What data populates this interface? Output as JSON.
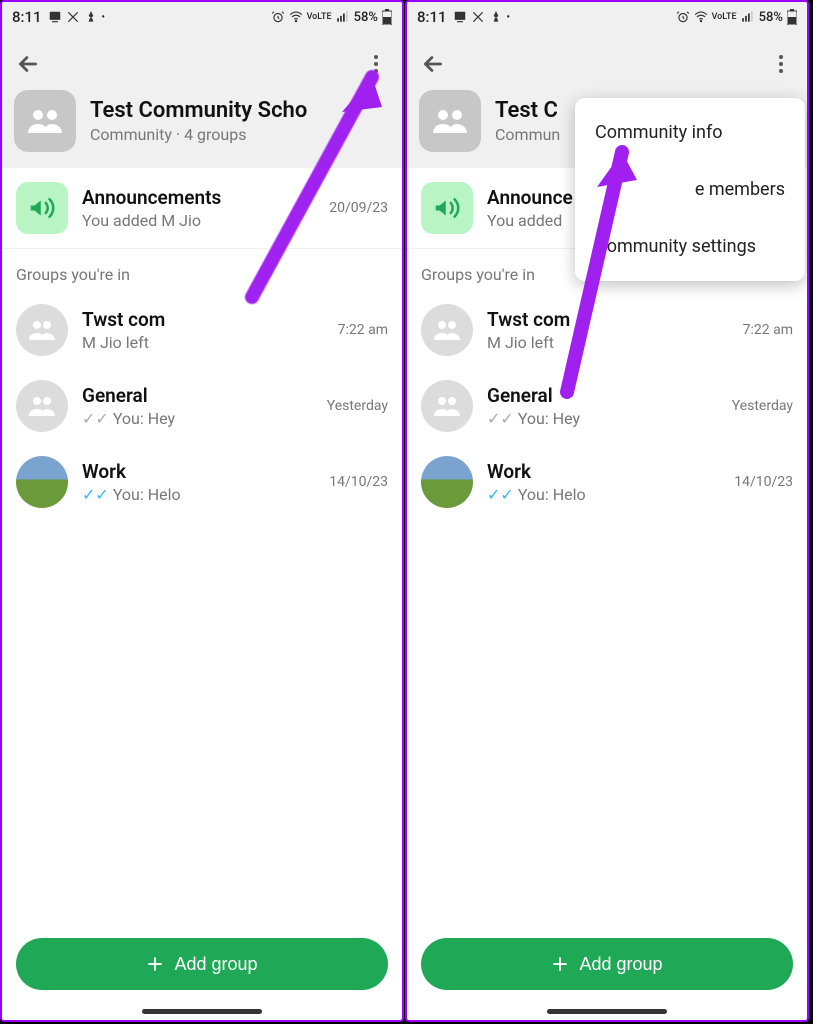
{
  "statusbar": {
    "time": "8:11",
    "battery": "58%"
  },
  "header": {
    "community_title": "Test Community School",
    "community_title_truncated_left": "Test Community Scho",
    "community_title_truncated_right": "Test C",
    "subtitle": "Community · 4 groups"
  },
  "announcements": {
    "title": "Announcements",
    "subtitle": "You added M Jio",
    "date": "20/09/23",
    "title_right": "Announce",
    "subtitle_right": "You added"
  },
  "section_header": "Groups you're in",
  "groups": [
    {
      "name": "Twst com",
      "sub": "M Jio left",
      "meta": "7:22 am"
    },
    {
      "name": "General",
      "sub_prefix": "You: ",
      "sub_msg": "Hey",
      "meta": "Yesterday"
    },
    {
      "name": "Work",
      "sub_prefix": "You: ",
      "sub_msg": "Helo",
      "meta": "14/10/23"
    }
  ],
  "add_group": "Add group",
  "menu": {
    "item1": "Community info",
    "item2": "e members",
    "item3": "Community settings"
  }
}
